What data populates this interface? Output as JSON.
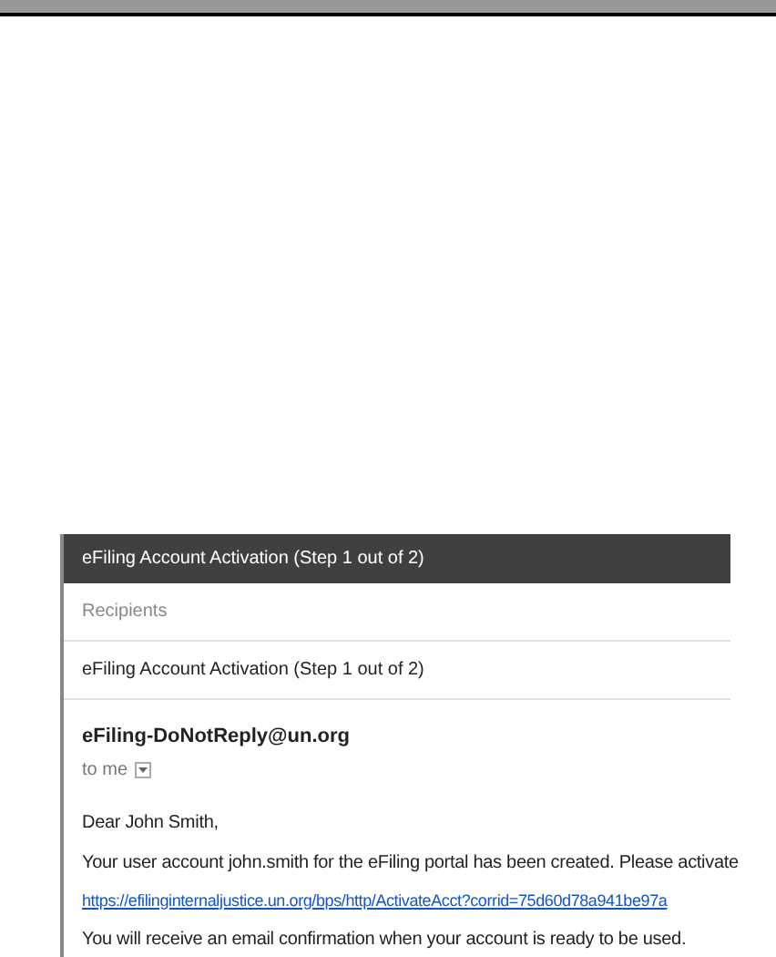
{
  "email": {
    "header_title": "eFiling Account Activation (Step 1 out of 2)",
    "recipients_placeholder": "Recipients",
    "subject": "eFiling Account Activation (Step 1 out of 2)",
    "sender": "eFiling-DoNotReply@un.org",
    "to": "to me",
    "body": [
      {
        "kind": "text",
        "text": "Dear John Smith,"
      },
      {
        "kind": "text",
        "text": "Your user account john.smith for the eFiling portal has been created. Please activate"
      },
      {
        "kind": "link",
        "text": "https://efilinginternaljustice.un.org/bps/http/ActivateAcct?corrid=75d60d78a941be97a"
      },
      {
        "kind": "text",
        "text": "You will receive an email confirmation when your account is ready to be used."
      }
    ]
  }
}
